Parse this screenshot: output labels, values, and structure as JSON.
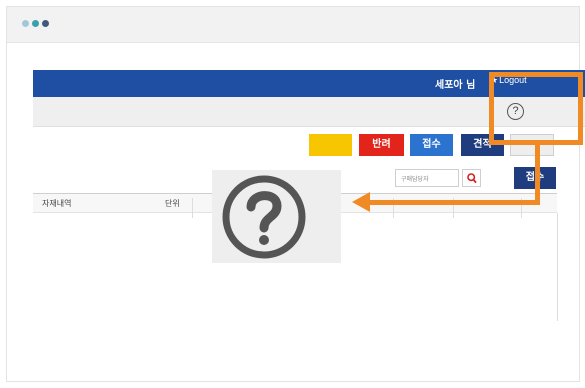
{
  "window": {
    "dots": [
      "#9ec9d8",
      "#37a2a8",
      "#3f5a7c"
    ]
  },
  "header": {
    "user_name": "세포아 님",
    "logout_label": "Logout",
    "logout_icon": "star-icon"
  },
  "subbar": {
    "help_label": "?"
  },
  "toolbar": {
    "buttons": [
      {
        "label": "반려",
        "color": "#e2241b"
      },
      {
        "label": "접수",
        "color": "#2c72cf"
      },
      {
        "label": "견적",
        "color": "#1e3c7e"
      }
    ]
  },
  "search": {
    "placeholder": "구매담당자",
    "receive_label": "접수"
  },
  "grid": {
    "columns": [
      "자재내역",
      "단위"
    ]
  },
  "highlight": {
    "color": "#f08a24",
    "icon": "question-circle-icon"
  }
}
